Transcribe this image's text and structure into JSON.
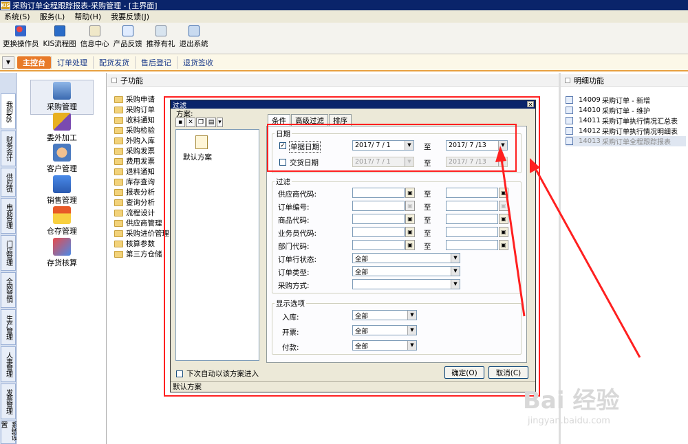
{
  "app": {
    "title": "采购订单全程跟踪报表-采购管理 - [主界面]",
    "logo": "KIS"
  },
  "menu": [
    "系统(S)",
    "服务(L)",
    "帮助(H)",
    "我要反馈(J)"
  ],
  "toolbar": [
    "更换操作员",
    "KIS流程图",
    "信息中心",
    "产品反馈",
    "推荐有礼",
    "退出系统"
  ],
  "tabs": {
    "active": "主控台",
    "items": [
      "订单处理",
      "配货发货",
      "售后登记",
      "退货签收"
    ]
  },
  "vtabs": [
    "我的KIS",
    "财务会计",
    "供应链",
    "电商管理",
    "门店管理",
    "全网营销",
    "生产管理",
    "人事管理",
    "发票管理",
    "系统设置"
  ],
  "modules": [
    "采购管理",
    "委外加工",
    "客户管理",
    "销售管理",
    "仓存管理",
    "存货核算"
  ],
  "sub": {
    "header": "子功能",
    "items": [
      "采购申请",
      "采购订单",
      "收料通知",
      "采购检验",
      "外购入库",
      "采购发票",
      "费用发票",
      "退料通知",
      "库存查询",
      "报表分析",
      "查询分析",
      "流程设计",
      "供应商管理",
      "采购进价管理",
      "核算参数",
      "第三方仓储"
    ]
  },
  "detail": {
    "header": "明细功能",
    "items": [
      {
        "code": "14009",
        "name": "采购订单 - 新增"
      },
      {
        "code": "14010",
        "name": "采购订单 - 维护"
      },
      {
        "code": "14011",
        "name": "采购订单执行情况汇总表"
      },
      {
        "code": "14012",
        "name": "采购订单执行情况明细表"
      },
      {
        "code": "14013",
        "name": "采购订单全程跟踪报表"
      }
    ]
  },
  "dialog": {
    "title": "过滤",
    "scheme_label": "方案:",
    "scheme_item": "默认方案",
    "tabs": [
      "条件",
      "高级过滤",
      "排序"
    ],
    "date_group": "日期",
    "doc_date_label": "单据日期",
    "doc_date_checked": "✓",
    "doc_date_from": "2017/ 7 / 1",
    "doc_date_to": "2017/ 7 /13",
    "to_label": "至",
    "deliv_date_label": "交货日期",
    "deliv_date_from": "2017/ 7 / 1",
    "deliv_date_to": "2017/ 7 /13",
    "filter_group": "过滤",
    "filter_fields": [
      "供应商代码:",
      "订单编号:",
      "商品代码:",
      "业务员代码:",
      "部门代码:"
    ],
    "row_status_label": "订单行状态:",
    "row_status_value": "全部",
    "order_type_label": "订单类型:",
    "order_type_value": "全部",
    "purchase_mode_label": "采购方式:",
    "purchase_mode_value": "",
    "display_group": "显示选项",
    "display_fields": [
      {
        "label": "入库:",
        "value": "全部"
      },
      {
        "label": "开票:",
        "value": "全部"
      },
      {
        "label": "付款:",
        "value": "全部"
      }
    ],
    "auto_enter": "下次自动以该方案进入",
    "ok": "确定(O)",
    "cancel": "取消(C)",
    "status": "默认方案"
  },
  "watermark": {
    "main": "Bai 经验",
    "sub": "jingyan.baidu.com"
  },
  "colors": {
    "titlebar": "#0a246a",
    "accent_tab": "#e87a28",
    "annotation": "#ff2020"
  }
}
